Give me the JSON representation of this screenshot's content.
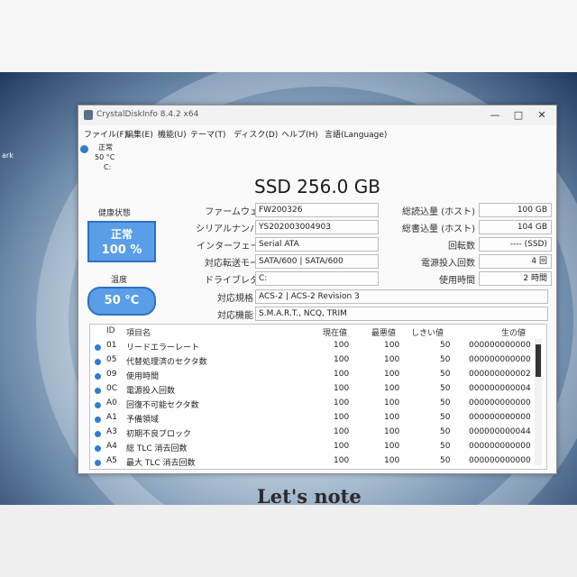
{
  "desktop": {
    "icon_label": "ark"
  },
  "window": {
    "title": "CrystalDiskInfo 8.4.2 x64",
    "buttons": {
      "minimize": "—",
      "maximize": "□",
      "close": "✕"
    }
  },
  "menu": [
    "ファイル(F)",
    "編集(E)",
    "機能(U)",
    "テーマ(T)",
    "ディスク(D)",
    "ヘルプ(H)",
    "言語(Language)"
  ],
  "drive_tab": {
    "status": "正常",
    "temp": "50 °C",
    "letter": "C:"
  },
  "drive_title": "SSD 256.0 GB",
  "health": {
    "label": "健康状態",
    "status": "正常",
    "percent": "100 %"
  },
  "temperature": {
    "label": "温度",
    "value": "50 °C"
  },
  "info_left": [
    {
      "label": "ファームウェア",
      "value": "FW200326"
    },
    {
      "label": "シリアルナンバー",
      "value": "YS202003004903"
    },
    {
      "label": "インターフェース",
      "value": "Serial ATA"
    },
    {
      "label": "対応転送モード",
      "value": "SATA/600 | SATA/600"
    },
    {
      "label": "ドライブレター",
      "value": "C:"
    }
  ],
  "info_right": [
    {
      "label": "総読込量 (ホスト)",
      "value": "100 GB"
    },
    {
      "label": "総書込量 (ホスト)",
      "value": "104 GB"
    },
    {
      "label": "回転数",
      "value": "---- (SSD)"
    },
    {
      "label": "電源投入回数",
      "value": "4 回"
    },
    {
      "label": "使用時間",
      "value": "2 時間"
    }
  ],
  "standard": {
    "label": "対応規格",
    "value": "ACS-2 | ACS-2 Revision 3"
  },
  "features": {
    "label": "対応機能",
    "value": "S.M.A.R.T., NCQ, TRIM"
  },
  "smart": {
    "headers": [
      "ID",
      "項目名",
      "現在値",
      "最悪値",
      "しきい値",
      "生の値"
    ],
    "rows": [
      {
        "id": "01",
        "name": "リードエラーレート",
        "current": "100",
        "worst": "100",
        "threshold": "50",
        "raw": "000000000000"
      },
      {
        "id": "05",
        "name": "代替処理済のセクタ数",
        "current": "100",
        "worst": "100",
        "threshold": "50",
        "raw": "000000000000"
      },
      {
        "id": "09",
        "name": "使用時間",
        "current": "100",
        "worst": "100",
        "threshold": "50",
        "raw": "000000000002"
      },
      {
        "id": "0C",
        "name": "電源投入回数",
        "current": "100",
        "worst": "100",
        "threshold": "50",
        "raw": "000000000004"
      },
      {
        "id": "A0",
        "name": "回復不可能セクタ数",
        "current": "100",
        "worst": "100",
        "threshold": "50",
        "raw": "000000000000"
      },
      {
        "id": "A1",
        "name": "予備領域",
        "current": "100",
        "worst": "100",
        "threshold": "50",
        "raw": "000000000000"
      },
      {
        "id": "A3",
        "name": "初期不良ブロック",
        "current": "100",
        "worst": "100",
        "threshold": "50",
        "raw": "000000000044"
      },
      {
        "id": "A4",
        "name": "総 TLC 消去回数",
        "current": "100",
        "worst": "100",
        "threshold": "50",
        "raw": "000000000000"
      },
      {
        "id": "A5",
        "name": "最大 TLC 消去回数",
        "current": "100",
        "worst": "100",
        "threshold": "50",
        "raw": "000000000000"
      }
    ]
  },
  "brand": "Let's note",
  "colors": {
    "health_blue": "#5a9ee8",
    "dot_blue": "#2f7dd3"
  }
}
